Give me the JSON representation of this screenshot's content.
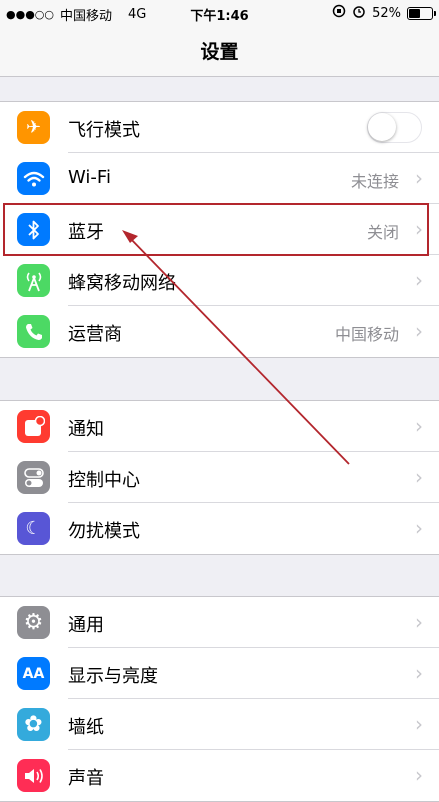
{
  "status_bar": {
    "signal": "●●●○○",
    "carrier": "中国移动",
    "network": "4G",
    "time": "下午1:46",
    "battery_percent": "52%",
    "battery_level": 0.52
  },
  "nav": {
    "title": "设置"
  },
  "group1": [
    {
      "id": "airplane",
      "label": "飞行模式",
      "value": "",
      "control": "toggle",
      "icon": "airplane-icon",
      "color": "#ff9500",
      "glyph": "✈"
    },
    {
      "id": "wifi",
      "label": "Wi-Fi",
      "value": "未连接",
      "control": "chevron",
      "icon": "wifi-icon",
      "color": "#007aff",
      "glyph": ""
    },
    {
      "id": "bluetooth",
      "label": "蓝牙",
      "value": "关闭",
      "control": "chevron",
      "icon": "bluetooth-icon",
      "color": "#007aff",
      "glyph": ""
    },
    {
      "id": "cellular",
      "label": "蜂窝移动网络",
      "value": "",
      "control": "chevron",
      "icon": "cellular-antenna-icon",
      "color": "#4cd964",
      "glyph": ""
    },
    {
      "id": "carrier",
      "label": "运营商",
      "value": "中国移动",
      "control": "chevron",
      "icon": "phone-icon",
      "color": "#4cd964",
      "glyph": ""
    }
  ],
  "group2": [
    {
      "id": "notifications",
      "label": "通知",
      "value": "",
      "control": "chevron",
      "icon": "notification-icon",
      "color": "#ff3b30",
      "glyph": ""
    },
    {
      "id": "control-center",
      "label": "控制中心",
      "value": "",
      "control": "chevron",
      "icon": "switches-icon",
      "color": "#8e8e93",
      "glyph": ""
    },
    {
      "id": "do-not-disturb",
      "label": "勿扰模式",
      "value": "",
      "control": "chevron",
      "icon": "moon-icon",
      "color": "#5856d6",
      "glyph": "☾"
    }
  ],
  "group3": [
    {
      "id": "general",
      "label": "通用",
      "value": "",
      "control": "chevron",
      "icon": "gear-icon",
      "color": "#8e8e93",
      "glyph": "⚙"
    },
    {
      "id": "display",
      "label": "显示与亮度",
      "value": "",
      "control": "chevron",
      "icon": "text-size-icon",
      "color": "#007aff",
      "glyph": "AA"
    },
    {
      "id": "wallpaper",
      "label": "墙纸",
      "value": "",
      "control": "chevron",
      "icon": "flower-icon",
      "color": "#34aadc",
      "glyph": "✿"
    },
    {
      "id": "sounds",
      "label": "声音",
      "value": "",
      "control": "chevron",
      "icon": "speaker-icon",
      "color": "#ff2d55",
      "glyph": ""
    }
  ],
  "chevron": "›",
  "annotation": {
    "highlight_color": "#b3262d"
  }
}
